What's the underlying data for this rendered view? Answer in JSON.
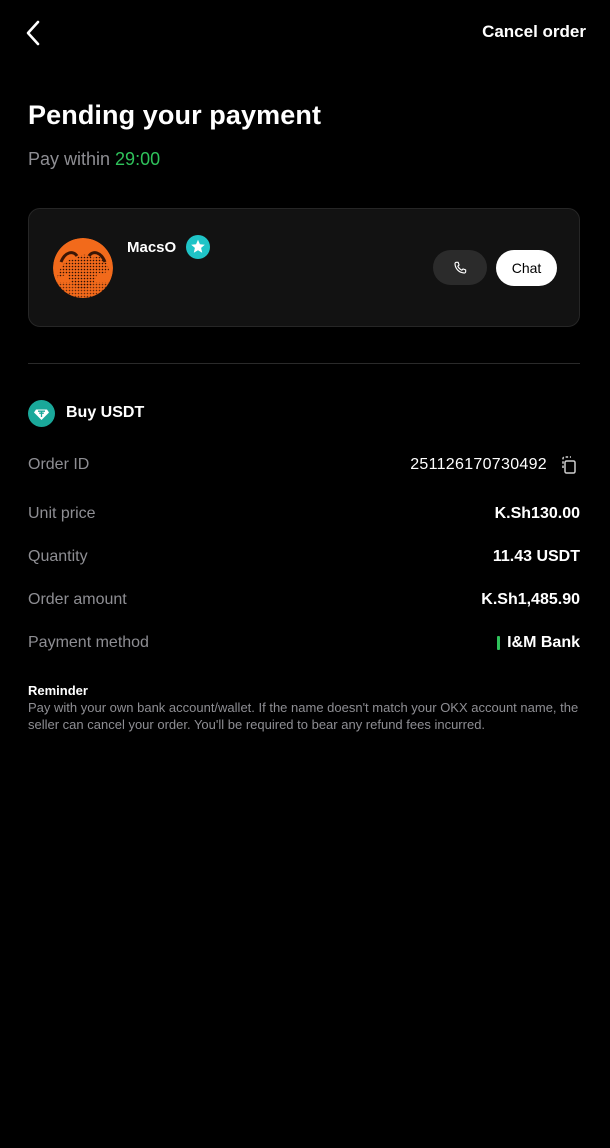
{
  "header": {
    "back_icon": "chevron-left-icon",
    "cancel_label": "Cancel order"
  },
  "title": "Pending your payment",
  "pay_within": {
    "prefix": "Pay within ",
    "timer": "29:00",
    "timer_color": "#2fc25b"
  },
  "seller": {
    "name": "MacsO",
    "badge_icon": "verified-star-icon",
    "call_icon": "phone-icon",
    "chat_label": "Chat"
  },
  "trade": {
    "icon": "usdt-icon",
    "label": "Buy USDT"
  },
  "details": {
    "order_id": {
      "label": "Order ID",
      "value": "251126170730492",
      "copy_icon": "copy-icon"
    },
    "unit_price": {
      "label": "Unit price",
      "value": "K.Sh130.00"
    },
    "quantity": {
      "label": "Quantity",
      "value": "11.43 USDT"
    },
    "order_amount": {
      "label": "Order amount",
      "value": "K.Sh1,485.90"
    },
    "payment_method": {
      "label": "Payment method",
      "value": "I&M Bank",
      "marker_color": "#2fc25b"
    }
  },
  "reminder": {
    "title": "Reminder",
    "text": "Pay with your own bank account/wallet. If the name doesn't match your OKX account name, the seller can cancel your order. You'll be required to bear any refund fees incurred."
  }
}
